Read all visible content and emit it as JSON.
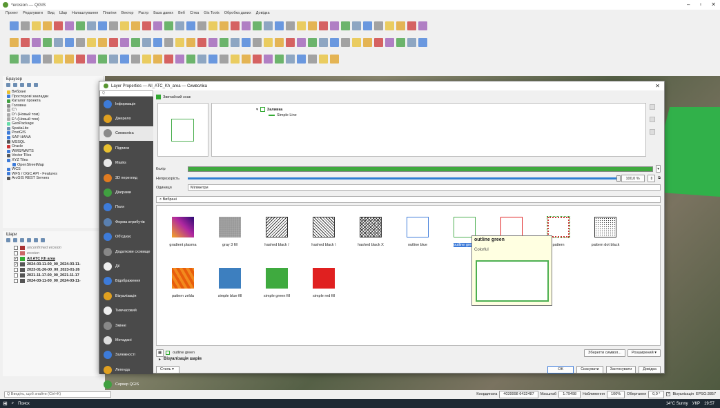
{
  "window": {
    "title": "*erosion — QGIS"
  },
  "menu": [
    "Проект",
    "Редагувати",
    "Вид",
    "Шар",
    "Налаштування",
    "Плагіни",
    "Вектор",
    "Растр",
    "База даних",
    "Веб",
    "Сітка",
    "Gis Tools",
    "Обробка даних",
    "Довідка"
  ],
  "browser": {
    "title": "Браузер",
    "items": [
      "Вибрані",
      "Просторові закладки",
      "Каталог проекта",
      "Головна",
      "C:\\",
      "D:\\ (Новый том)",
      "E:\\ (Новый том)",
      "GeoPackage",
      "SpatiaLite",
      "PostGIS",
      "SAP HANA",
      "MSSQL",
      "Oracle",
      "WMS/WMTS",
      "Vector Tiles",
      "XYZ Tiles",
      "OpenStreetMap",
      "WCS",
      "WFS / OGC API - Features",
      "ArcGIS REST Servers"
    ]
  },
  "layers": {
    "title": "Шари",
    "items": [
      {
        "name": "unconfirmed erosion",
        "checked": false,
        "color": "#a33"
      },
      {
        "name": "erosion",
        "checked": false,
        "color": "#c66"
      },
      {
        "name": "All ATC Kh area",
        "checked": true,
        "color": "#3a3"
      },
      {
        "name": "2024-03-11-00_00_2024-03-11-",
        "checked": true,
        "color": "#555"
      },
      {
        "name": "2023-01-26-00_00_2023-01-26",
        "checked": false,
        "color": "#555"
      },
      {
        "name": "2021-11-17-00_00_2021-11-17",
        "checked": false,
        "color": "#555"
      },
      {
        "name": "2024-03-11-00_00_2024-03-11-",
        "checked": false,
        "color": "#555"
      }
    ]
  },
  "dialog": {
    "title": "Layer Properties — All_ATC_Kh_area — Символіка",
    "search_placeholder": "Q",
    "nav": [
      {
        "label": "Інформація",
        "color": "#3d7bd9"
      },
      {
        "label": "Джерело",
        "color": "#e0a020"
      },
      {
        "label": "Символіка",
        "color": "#8a8a8a"
      },
      {
        "label": "Підписи",
        "color": "#e8c030"
      },
      {
        "label": "Masks",
        "color": "#e8e8e8"
      },
      {
        "label": "3D перегляд",
        "color": "#e07b20"
      },
      {
        "label": "Діаграми",
        "color": "#40a040"
      },
      {
        "label": "Поля",
        "color": "#3d7bd9"
      },
      {
        "label": "Форма атрибутів",
        "color": "#5a80b0"
      },
      {
        "label": "Об'єднує",
        "color": "#3d7bd9"
      },
      {
        "label": "Додаткове сховище",
        "color": "#888"
      },
      {
        "label": "Дії",
        "color": "#eee"
      },
      {
        "label": "Відображення",
        "color": "#3d7bd9"
      },
      {
        "label": "Візуалізація",
        "color": "#e0a020"
      },
      {
        "label": "Тимчасовий",
        "color": "#eee"
      },
      {
        "label": "Змінні",
        "color": "#888"
      },
      {
        "label": "Метадані",
        "color": "#ddd"
      },
      {
        "label": "Залежності",
        "color": "#3d7bd9"
      },
      {
        "label": "Легенда",
        "color": "#e0a020"
      },
      {
        "label": "Сервер QGIS",
        "color": "#40a040"
      }
    ],
    "selected_nav": "Символіка",
    "renderer": "Звичайний знак",
    "symbol_tree": {
      "fill": "Заливка",
      "line": "Simple Line"
    },
    "color_label": "Колір",
    "opacity_label": "Непрозорість",
    "opacity_value": "100,0 %",
    "opacity": 1.0,
    "units_label": "Одиниця",
    "units_value": "Міліметри",
    "fav_search": "Вибрані",
    "symbols": [
      {
        "label": "gradient plasma",
        "swatch": "gradient"
      },
      {
        "label": "gray 3 fill",
        "swatch": "gray"
      },
      {
        "label": "hashed black /",
        "swatch": "hash1"
      },
      {
        "label": "hashed black \\",
        "swatch": "hash2"
      },
      {
        "label": "hashed black X",
        "swatch": "hashx"
      },
      {
        "label": "outline blue",
        "swatch": "oblue"
      },
      {
        "label": "outline green",
        "swatch": "ogreen",
        "selected": true
      },
      {
        "label": "outline red",
        "swatch": "ored"
      },
      {
        "label": "pattern",
        "swatch": "pattern"
      },
      {
        "label": "pattern dot black",
        "swatch": "dot"
      },
      {
        "label": "pattern zelda",
        "swatch": "zelda"
      },
      {
        "label": "simple blue fill",
        "swatch": "sblue"
      },
      {
        "label": "simple green fill",
        "swatch": "sgreen"
      },
      {
        "label": "simple red fill",
        "swatch": "sred"
      }
    ],
    "tooltip": {
      "title": "outline green",
      "subtitle": "Colorful"
    },
    "selected_symbol_name": "outline green",
    "save_symbol": "Зберегти символ...",
    "advanced": "Розширений ▾",
    "layer_rendering": "Візуалізація шарів",
    "style_btn": "Стиль",
    "ok": "OK",
    "cancel": "Скасувати",
    "apply": "Застосувати",
    "help": "Довідка"
  },
  "status": {
    "search": "Q Введіть, щоб знайти (Ctrl+K)",
    "coord_label": "Координата",
    "coord": "4039998 6432487",
    "scale_label": "Масштаб",
    "scale": "1:79498",
    "zoom_label": "Наближення",
    "zoom": "100%",
    "rotation_label": "Обертання",
    "rotation": "0,0 °",
    "render_label": "Візуалізація",
    "crs": "EPSG:3857"
  },
  "taskbar": {
    "search": "Поиск",
    "weather": "14°C Sunny",
    "lang": "УКР",
    "time": "19:57"
  }
}
